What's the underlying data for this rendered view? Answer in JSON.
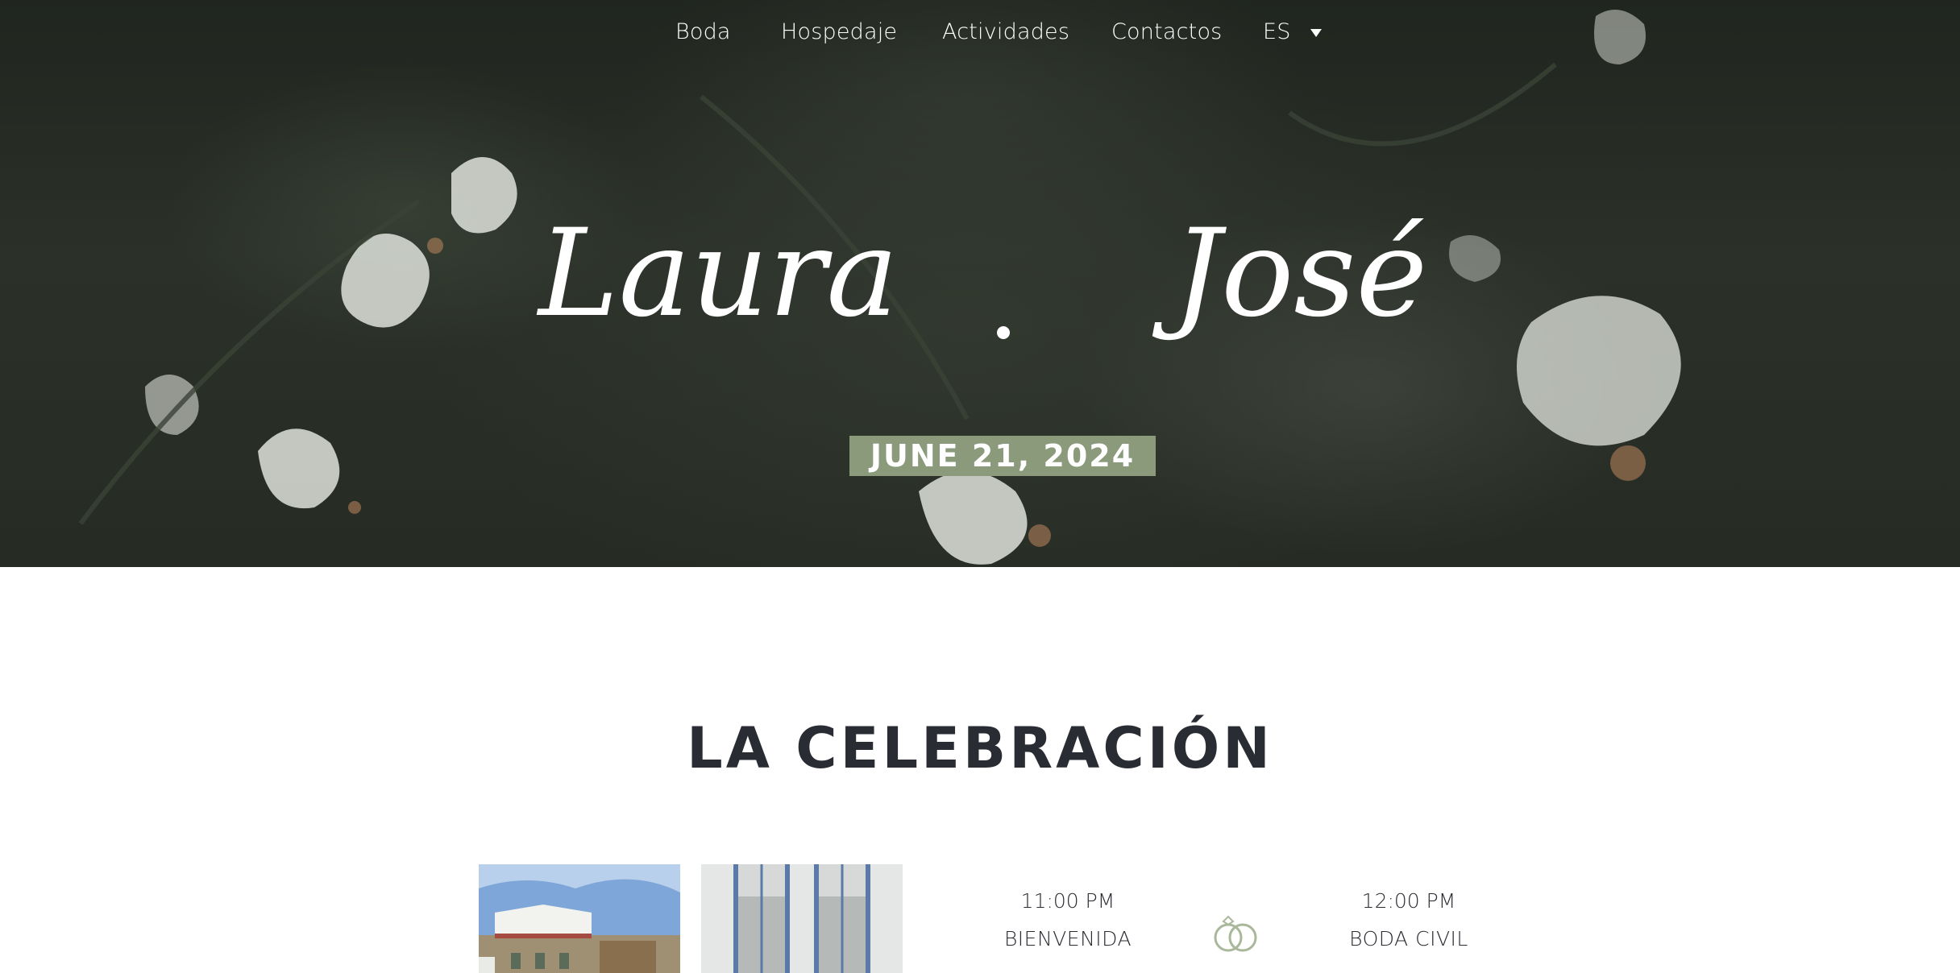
{
  "nav": {
    "items": [
      {
        "label": "Boda"
      },
      {
        "label": "Hospedaje"
      },
      {
        "label": "Actividades"
      },
      {
        "label": "Contactos"
      }
    ],
    "language": "ES"
  },
  "hero": {
    "name_left": "Laura",
    "name_right": "José",
    "date": "JUNE 21, 2024"
  },
  "celebration": {
    "title": "LA CELEBRACIÓN",
    "events": [
      {
        "time": "11:00 PM",
        "label": "BIENVENIDA"
      },
      {
        "time": "12:00 PM",
        "label": "BODA CIVIL"
      }
    ],
    "icon": "rings-icon"
  },
  "colors": {
    "accent": "#8a9a7b",
    "title": "#2a2c33",
    "hero_bg": "#262b24"
  }
}
